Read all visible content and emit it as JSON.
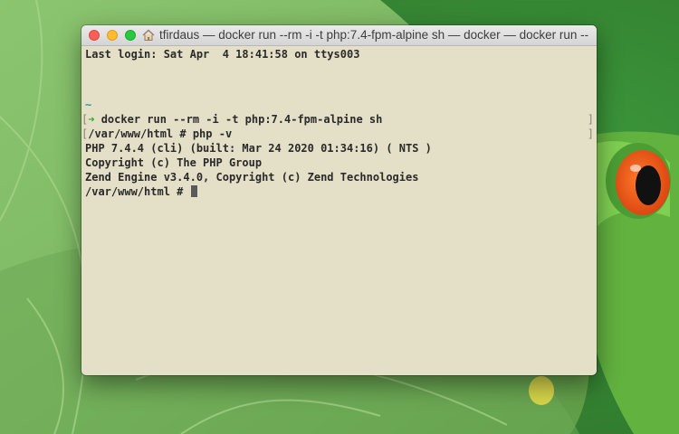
{
  "window": {
    "title": "tfirdaus — docker run --rm -i -t php:7.4-fpm-alpine sh — docker — docker run --rm -i -t"
  },
  "terminal": {
    "last_login": "Last login: Sat Apr  4 18:41:58 on ttys003",
    "cwd_line": "~",
    "prompt_arrow": "➜",
    "command_docker": "docker run --rm -i -t php:7.4-fpm-alpine sh",
    "command_php": "/var/www/html # php -v",
    "output_1": "PHP 7.4.4 (cli) (built: Mar 24 2020 01:34:16) ( NTS )",
    "output_2": "Copyright (c) The PHP Group",
    "output_3": "Zend Engine v3.4.0, Copyright (c) Zend Technologies",
    "current_prompt": "/var/www/html # ",
    "bracket_left": "[",
    "bracket_right": "]"
  },
  "colors": {
    "terminal_bg": "#e4dfc7",
    "prompt_green": "#2eaa2e",
    "tilde_teal": "#2f9a8a",
    "close": "#fc5f57",
    "minimize": "#fdbc2e",
    "zoom": "#28c840"
  },
  "icons": {
    "window_proxy": "home-icon"
  }
}
